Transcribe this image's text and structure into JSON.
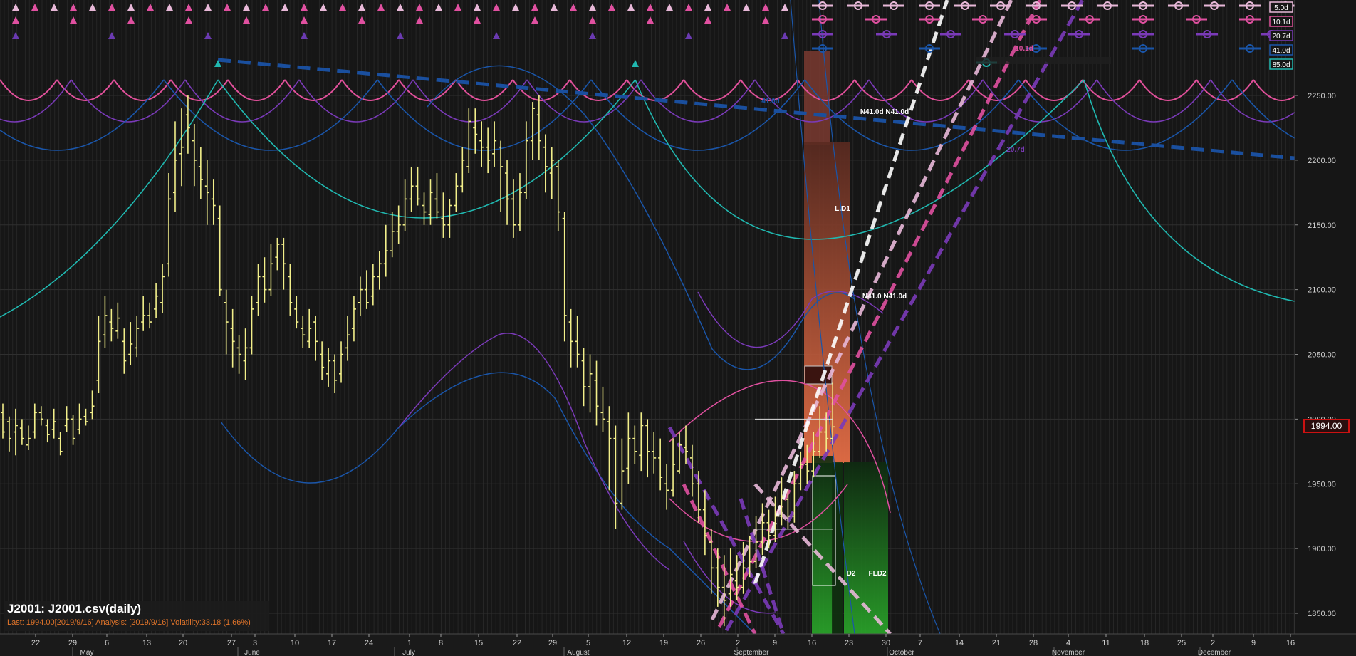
{
  "chart_data": {
    "type": "bar",
    "title": "J2001: J2001.csv(daily)",
    "subtitle": "Last: 1994.00[2019/9/16] Analysis: [2019/9/16] Volatility:33.18 (1.66%)",
    "last_price": "1994.00",
    "yaxis": {
      "range": [
        1835,
        2300
      ],
      "ticks": [
        "1850.00",
        "1900.00",
        "1950.00",
        "2000.00",
        "2050.00",
        "2100.00",
        "2150.00",
        "2200.00",
        "2250.00"
      ]
    },
    "xaxis": {
      "days": [
        "22",
        "29",
        "6",
        "13",
        "20",
        "27",
        "3",
        "10",
        "17",
        "24",
        "1",
        "8",
        "15",
        "22",
        "29",
        "5",
        "12",
        "19",
        "26",
        "2",
        "9",
        "16",
        "23",
        "30",
        "7",
        "14",
        "21",
        "28",
        "4",
        "11",
        "18",
        "25",
        "2",
        "9",
        "16"
      ],
      "months": [
        "May",
        "June",
        "July",
        "August",
        "September",
        "October",
        "November",
        "December"
      ]
    },
    "cycle_legend": [
      "5.0d",
      "10.1d",
      "20.7d",
      "41.0d",
      "85.0d"
    ],
    "cycle_colors": [
      "#e8b8d8",
      "#e0509a",
      "#7a3ab8",
      "#1a55a8",
      "#20b8b0"
    ],
    "annotations": [
      "10.1d",
      "41.0d",
      "N41.0d N41.0d",
      "20.7d",
      "L.D1",
      "N41.0 N41.0d",
      "D2",
      "FLD2"
    ],
    "series": [
      {
        "color": "#f2ef8a",
        "ohlc": [
          [
            2005,
            1990,
            2012,
            1985
          ],
          [
            1998,
            1985,
            2002,
            1975
          ],
          [
            1990,
            1995,
            2008,
            1972
          ],
          [
            1993,
            1985,
            2000,
            1980
          ],
          [
            1980,
            1985,
            1995,
            1976
          ],
          [
            1990,
            2005,
            2012,
            1985
          ],
          [
            2005,
            2000,
            2010,
            1995
          ],
          [
            1995,
            1988,
            2000,
            1982
          ],
          [
            1992,
            1998,
            2008,
            1985
          ],
          [
            1985,
            1975,
            1990,
            1972
          ],
          [
            1995,
            2000,
            2010,
            1990
          ],
          [
            2000,
            1985,
            2003,
            1980
          ],
          [
            1992,
            2000,
            2012,
            1988
          ],
          [
            2002,
            1998,
            2008,
            1995
          ],
          [
            2005,
            2010,
            2022,
            2000
          ],
          [
            2030,
            2060,
            2080,
            2020
          ],
          [
            2065,
            2080,
            2095,
            2055
          ],
          [
            2075,
            2070,
            2085,
            2060
          ],
          [
            2068,
            2078,
            2090,
            2062
          ],
          [
            2060,
            2045,
            2070,
            2035
          ],
          [
            2050,
            2058,
            2075,
            2042
          ],
          [
            2055,
            2070,
            2080,
            2048
          ],
          [
            2075,
            2080,
            2095,
            2068
          ],
          [
            2080,
            2075,
            2090,
            2070
          ],
          [
            2085,
            2095,
            2105,
            2078
          ],
          [
            2090,
            2110,
            2120,
            2082
          ],
          [
            2120,
            2170,
            2190,
            2110
          ],
          [
            2175,
            2200,
            2230,
            2160
          ],
          [
            2205,
            2210,
            2240,
            2180
          ],
          [
            2235,
            2225,
            2250,
            2205
          ],
          [
            2215,
            2200,
            2228,
            2180
          ],
          [
            2195,
            2185,
            2210,
            2170
          ],
          [
            2180,
            2175,
            2200,
            2150
          ],
          [
            2170,
            2165,
            2185,
            2150
          ],
          [
            2155,
            2100,
            2165,
            2095
          ],
          [
            2090,
            2075,
            2100,
            2050
          ],
          [
            2070,
            2060,
            2085,
            2040
          ],
          [
            2055,
            2050,
            2065,
            2035
          ],
          [
            2045,
            2055,
            2070,
            2030
          ],
          [
            2055,
            2085,
            2095,
            2050
          ],
          [
            2090,
            2110,
            2120,
            2080
          ],
          [
            2110,
            2100,
            2125,
            2090
          ],
          [
            2100,
            2120,
            2135,
            2095
          ],
          [
            2125,
            2135,
            2140,
            2115
          ],
          [
            2135,
            2120,
            2140,
            2100
          ],
          [
            2110,
            2090,
            2120,
            2080
          ],
          [
            2085,
            2075,
            2095,
            2070
          ],
          [
            2070,
            2065,
            2080,
            2055
          ],
          [
            2060,
            2070,
            2085,
            2055
          ],
          [
            2075,
            2060,
            2080,
            2045
          ],
          [
            2050,
            2040,
            2060,
            2030
          ],
          [
            2035,
            2045,
            2055,
            2025
          ],
          [
            2045,
            2030,
            2050,
            2020
          ],
          [
            2035,
            2050,
            2060,
            2028
          ],
          [
            2055,
            2065,
            2080,
            2045
          ],
          [
            2070,
            2085,
            2095,
            2060
          ],
          [
            2090,
            2100,
            2110,
            2080
          ],
          [
            2100,
            2090,
            2115,
            2085
          ],
          [
            2095,
            2110,
            2120,
            2088
          ],
          [
            2110,
            2120,
            2130,
            2100
          ],
          [
            2120,
            2130,
            2150,
            2110
          ],
          [
            2130,
            2145,
            2160,
            2125
          ],
          [
            2145,
            2150,
            2165,
            2135
          ],
          [
            2150,
            2170,
            2185,
            2145
          ],
          [
            2170,
            2180,
            2195,
            2160
          ],
          [
            2180,
            2170,
            2195,
            2165
          ],
          [
            2165,
            2160,
            2175,
            2150
          ],
          [
            2158,
            2175,
            2185,
            2150
          ],
          [
            2170,
            2160,
            2190,
            2155
          ],
          [
            2155,
            2150,
            2175,
            2140
          ],
          [
            2150,
            2165,
            2170,
            2140
          ],
          [
            2165,
            2180,
            2190,
            2160
          ],
          [
            2180,
            2200,
            2210,
            2175
          ],
          [
            2195,
            2230,
            2240,
            2190
          ],
          [
            2225,
            2220,
            2240,
            2205
          ],
          [
            2215,
            2210,
            2230,
            2195
          ],
          [
            2210,
            2200,
            2225,
            2190
          ],
          [
            2205,
            2215,
            2230,
            2195
          ],
          [
            2210,
            2195,
            2215,
            2160
          ],
          [
            2190,
            2170,
            2200,
            2150
          ],
          [
            2170,
            2150,
            2185,
            2140
          ],
          [
            2150,
            2175,
            2190,
            2145
          ],
          [
            2175,
            2215,
            2230,
            2170
          ],
          [
            2215,
            2240,
            2245,
            2200
          ],
          [
            2235,
            2215,
            2250,
            2200
          ],
          [
            2210,
            2195,
            2220,
            2175
          ],
          [
            2190,
            2200,
            2210,
            2170
          ],
          [
            2195,
            2160,
            2200,
            2145
          ],
          [
            2155,
            2080,
            2160,
            2060
          ],
          [
            2075,
            2060,
            2085,
            2040
          ],
          [
            2060,
            2050,
            2080,
            2040
          ],
          [
            2045,
            2025,
            2055,
            2010
          ],
          [
            2025,
            2035,
            2050,
            2005
          ],
          [
            2030,
            2010,
            2045,
            1995
          ],
          [
            2005,
            2000,
            2025,
            1990
          ],
          [
            1998,
            1985,
            2010,
            1945
          ],
          [
            1985,
            1935,
            1995,
            1915
          ],
          [
            1935,
            1960,
            1985,
            1930
          ],
          [
            1962,
            1985,
            2005,
            1950
          ],
          [
            1985,
            1975,
            1995,
            1965
          ],
          [
            1972,
            1995,
            2005,
            1960
          ],
          [
            1995,
            1975,
            2000,
            1955
          ],
          [
            1975,
            1970,
            1990,
            1958
          ],
          [
            1970,
            1955,
            1985,
            1945
          ],
          [
            1950,
            1945,
            1965,
            1930
          ],
          [
            1945,
            1965,
            1985,
            1940
          ],
          [
            1960,
            1980,
            1990,
            1958
          ],
          [
            1978,
            1975,
            1995,
            1965
          ],
          [
            1970,
            1950,
            1980,
            1940
          ],
          [
            1950,
            1930,
            1960,
            1920
          ],
          [
            1930,
            1910,
            1945,
            1895
          ],
          [
            1905,
            1885,
            1915,
            1865
          ],
          [
            1885,
            1870,
            1900,
            1855
          ],
          [
            1870,
            1860,
            1895,
            1840
          ],
          [
            1865,
            1880,
            1900,
            1855
          ],
          [
            1875,
            1870,
            1895,
            1860
          ],
          [
            1870,
            1885,
            1905,
            1865
          ],
          [
            1885,
            1890,
            1910,
            1878
          ],
          [
            1890,
            1905,
            1925,
            1885
          ],
          [
            1905,
            1920,
            1935,
            1895
          ],
          [
            1920,
            1910,
            1930,
            1900
          ],
          [
            1910,
            1925,
            1940,
            1905
          ],
          [
            1925,
            1940,
            1955,
            1918
          ],
          [
            1938,
            1925,
            1945,
            1915
          ],
          [
            1925,
            1950,
            1960,
            1920
          ],
          [
            1950,
            1965,
            1975,
            1945
          ],
          [
            1965,
            1960,
            1980,
            1950
          ],
          [
            1960,
            1975,
            1990,
            1955
          ],
          [
            1975,
            1990,
            2010,
            1970
          ],
          [
            1990,
            1985,
            2005,
            1975
          ],
          [
            1985,
            1994,
            2028,
            1980
          ]
        ]
      }
    ]
  }
}
